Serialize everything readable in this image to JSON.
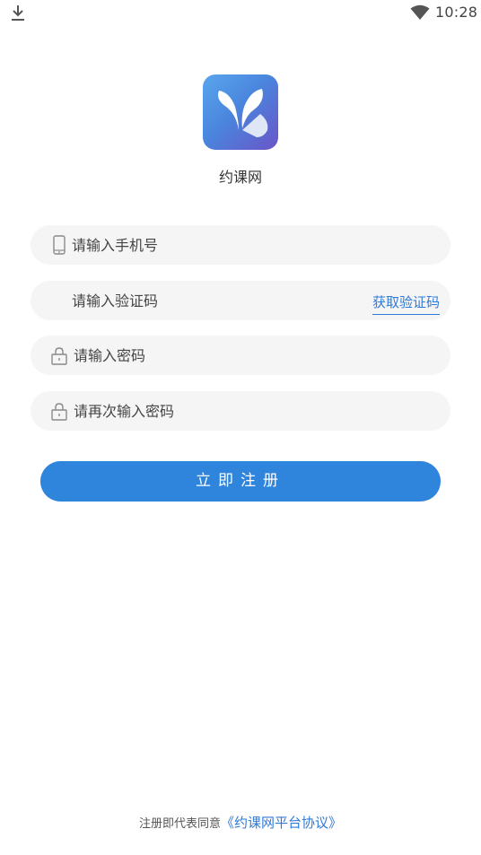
{
  "status_bar": {
    "time": "10:28",
    "icons": [
      "download-icon",
      "wifi-icon"
    ]
  },
  "app": {
    "name": "约课网",
    "logo_colors": [
      "#5aa6ee",
      "#4a86dd",
      "#6a54c8"
    ]
  },
  "form": {
    "phone_placeholder": "请输入手机号",
    "code_placeholder": "请输入验证码",
    "get_code_label": "获取验证码",
    "password_placeholder": "请输入密码",
    "confirm_password_placeholder": "请再次输入密码",
    "register_label": "立即注册"
  },
  "footer": {
    "agreement_prefix": "注册即代表同意",
    "agreement_link": "《约课网平台协议》"
  },
  "colors": {
    "accent": "#2f84dc",
    "link": "#2f7ad6",
    "field_bg": "#f5f5f5"
  }
}
